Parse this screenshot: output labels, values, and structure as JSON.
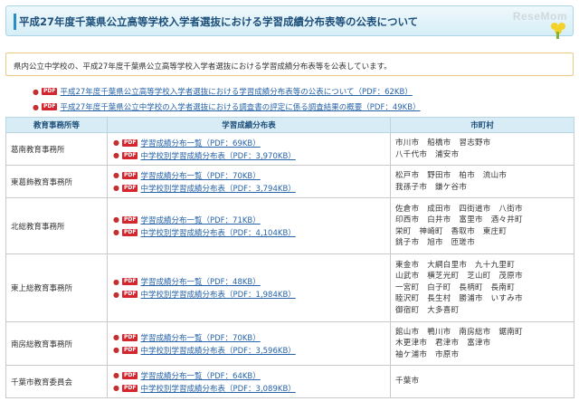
{
  "header": {
    "title": "平成27年度千葉県公立高等学校入学者選抜における学習成績分布表等の公表について",
    "logo": "ReseMom"
  },
  "intro": "県内公立中学校の、平成27年度千葉県公立高等学校入学者選抜における学習成績分布表等を公表しています。",
  "pdf_badge": "PDF",
  "links": [
    "平成27年度千葉県公立高等学校入学者選抜における学習成績分布表等の公表について（PDF：62KB）",
    "平成27年度千葉県公立中学校の入学者選抜における調査書の評定に係る調査結果の概要（PDF：49KB）"
  ],
  "table": {
    "headers": [
      "教育事務所等",
      "学習成績分布表",
      "市町村"
    ],
    "rows": [
      {
        "office": "葛南教育事務所",
        "files": [
          "学習成績分布一覧（PDF：69KB）",
          "中学校別学習成績分布表（PDF：3,970KB）"
        ],
        "cities": [
          "市川市　船橋市　習志野市",
          "八千代市　浦安市"
        ]
      },
      {
        "office": "東葛飾教育事務所",
        "files": [
          "学習成績分布一覧（PDF：70KB）",
          "中学校別学習成績分布表（PDF：3,794KB）"
        ],
        "cities": [
          "松戸市　野田市　柏市　流山市",
          "我孫子市　鎌ケ谷市"
        ]
      },
      {
        "office": "北総教育事務所",
        "files": [
          "学習成績分布一覧（PDF：71KB）",
          "中学校別学習成績分布表（PDF：4,104KB）"
        ],
        "cities": [
          "佐倉市　成田市　四街道市　八街市",
          "印西市　白井市　富里市　酒々井町",
          "栄町　神崎町　香取市　東庄町",
          "銚子市　旭市　匝瑳市"
        ]
      },
      {
        "office": "東上総教育事務所",
        "files": [
          "学習成績分布一覧（PDF：48KB）",
          "中学校別学習成績分布表（PDF：1,984KB）"
        ],
        "cities": [
          "東金市　大網白里市　九十九里町",
          "山武市　横芝光町　芝山町　茂原市",
          "一宮町　白子町　長柄町　長南町",
          "睦沢町　長生村　勝浦市　いすみ市",
          "御宿町　大多喜町"
        ]
      },
      {
        "office": "南房総教育事務所",
        "files": [
          "学習成績分布一覧（PDF：70KB）",
          "中学校別学習成績分布表（PDF：3,596KB）"
        ],
        "cities": [
          "館山市　鴨川市　南房総市　鋸南町",
          "木更津市　君津市　富津市",
          "袖ケ浦市　市原市"
        ]
      },
      {
        "office": "千葉市教育委員会",
        "files": [
          "学習成績分布一覧（PDF：64KB）",
          "中学校別学習成績分布表（PDF：3,089KB）"
        ],
        "cities": [
          "千葉市"
        ]
      }
    ]
  }
}
